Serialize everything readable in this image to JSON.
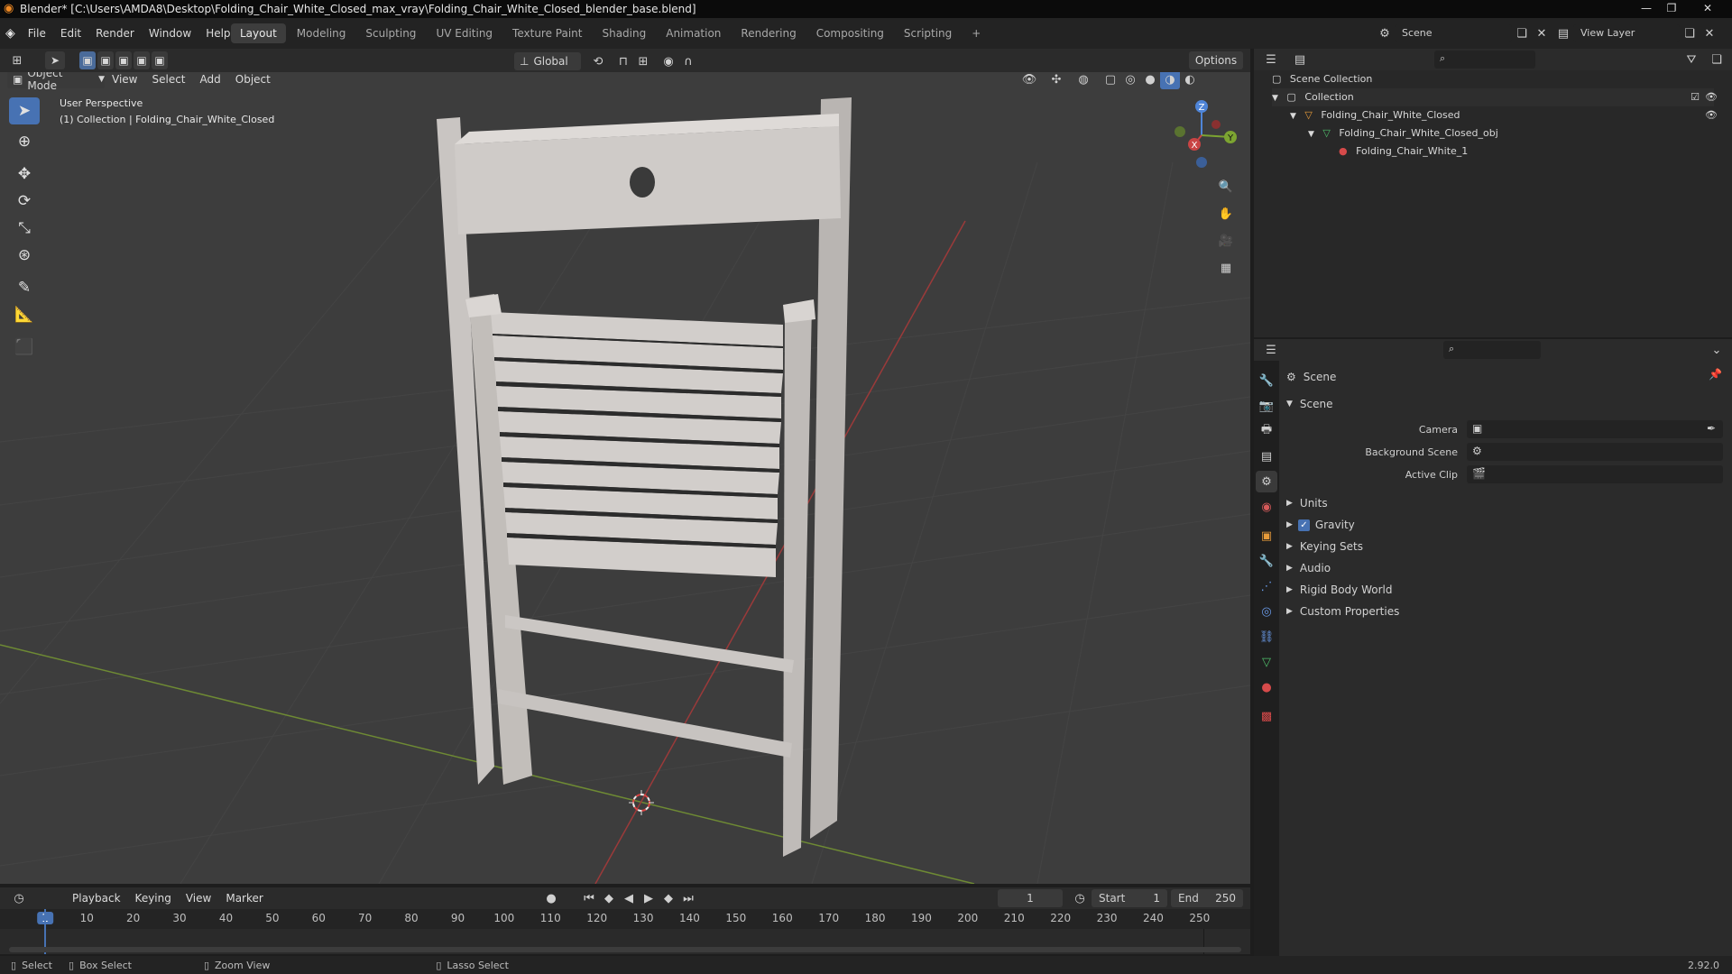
{
  "window": {
    "title": "Blender* [C:\\Users\\AMDA8\\Desktop\\Folding_Chair_White_Closed_max_vray\\Folding_Chair_White_Closed_blender_base.blend]"
  },
  "menu": [
    "File",
    "Edit",
    "Render",
    "Window",
    "Help"
  ],
  "workspaces": [
    "Layout",
    "Modeling",
    "Sculpting",
    "UV Editing",
    "Texture Paint",
    "Shading",
    "Animation",
    "Rendering",
    "Compositing",
    "Scripting"
  ],
  "active_workspace": "Layout",
  "scene_selector": {
    "value": "Scene"
  },
  "view_layer_selector": {
    "value": "View Layer"
  },
  "viewport_toolbar": {
    "transform_orientation": "Global",
    "options_label": "Options"
  },
  "viewport_header": {
    "mode": "Object Mode",
    "menus": [
      "View",
      "Select",
      "Add",
      "Object"
    ]
  },
  "viewport_overlay": {
    "line1": "User Perspective",
    "line2": "(1) Collection | Folding_Chair_White_Closed"
  },
  "gizmo": {
    "x": "X",
    "y": "Y",
    "z": "Z"
  },
  "outliner": {
    "root": "Scene Collection",
    "items": [
      {
        "label": "Collection"
      },
      {
        "label": "Folding_Chair_White_Closed"
      },
      {
        "label": "Folding_Chair_White_Closed_obj"
      },
      {
        "label": "Folding_Chair_White_1"
      }
    ]
  },
  "properties": {
    "header_title": "Scene",
    "section_title": "Scene",
    "fields": [
      {
        "label": "Camera"
      },
      {
        "label": "Background Scene"
      },
      {
        "label": "Active Clip"
      }
    ],
    "panels": [
      {
        "label": "Units",
        "checkbox": false
      },
      {
        "label": "Gravity",
        "checkbox": true
      },
      {
        "label": "Keying Sets",
        "checkbox": false
      },
      {
        "label": "Audio",
        "checkbox": false
      },
      {
        "label": "Rigid Body World",
        "checkbox": false
      },
      {
        "label": "Custom Properties",
        "checkbox": false
      }
    ]
  },
  "timeline": {
    "menus": [
      "Playback",
      "Keying",
      "View",
      "Marker"
    ],
    "current_frame": "1",
    "start_label": "Start",
    "start_value": "1",
    "end_label": "End",
    "end_value": "250",
    "ticks": [
      "1",
      "10",
      "20",
      "30",
      "40",
      "50",
      "60",
      "70",
      "80",
      "90",
      "100",
      "110",
      "120",
      "130",
      "140",
      "150",
      "160",
      "170",
      "180",
      "190",
      "200",
      "210",
      "220",
      "230",
      "240",
      "250"
    ]
  },
  "statusbar": {
    "items": [
      "Select",
      "Box Select",
      "Zoom View",
      "Lasso Select"
    ],
    "version": "2.92.0"
  },
  "colors": {
    "accent": "#4772b3",
    "x_axis": "#c94444",
    "y_axis": "#7ca431",
    "z_axis": "#4f85d8"
  }
}
